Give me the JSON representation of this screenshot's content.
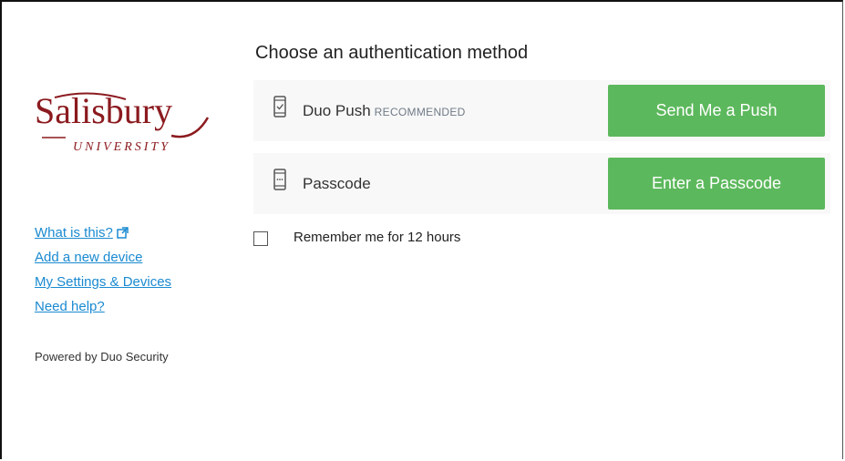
{
  "sidebar": {
    "logo": {
      "name": "Salisbury",
      "sub": "UNIVERSITY",
      "color": "#8b1a1f"
    },
    "links": [
      {
        "label": "What is this?",
        "icon": "external-link-icon"
      },
      {
        "label": "Add a new device"
      },
      {
        "label": "My Settings & Devices"
      },
      {
        "label": "Need help?"
      }
    ],
    "powered_by": "Powered by Duo Security"
  },
  "main": {
    "heading": "Choose an authentication method",
    "methods": [
      {
        "label": "Duo Push",
        "tag": "RECOMMENDED",
        "icon": "phone-check-icon",
        "button": "Send Me a Push"
      },
      {
        "label": "Passcode",
        "tag": "",
        "icon": "phone-passcode-icon",
        "button": "Enter a Passcode"
      }
    ],
    "remember": {
      "label": "Remember me for 12 hours",
      "checked": false
    }
  },
  "colors": {
    "button": "#5cb85c",
    "link": "#1a8ad0",
    "row_bg": "#f8f8f8"
  }
}
